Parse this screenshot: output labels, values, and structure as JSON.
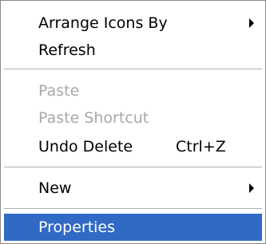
{
  "context_menu": {
    "items": [
      {
        "label": "Arrange Icons By",
        "has_submenu": true,
        "enabled": true
      },
      {
        "label": "Refresh",
        "enabled": true
      },
      {
        "label": "Paste",
        "enabled": false
      },
      {
        "label": "Paste Shortcut",
        "enabled": false
      },
      {
        "label": "Undo Delete",
        "shortcut": "Ctrl+Z",
        "enabled": true
      },
      {
        "label": "New",
        "has_submenu": true,
        "enabled": true
      },
      {
        "label": "Properties",
        "enabled": true,
        "highlighted": true
      }
    ],
    "highlight_color": "#316ac5",
    "disabled_text_color": "#a9a9a9"
  }
}
